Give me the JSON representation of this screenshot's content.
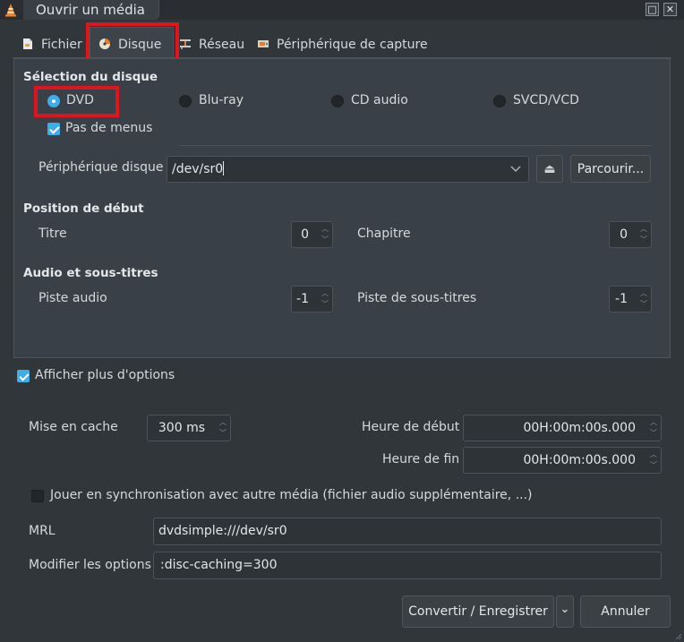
{
  "window": {
    "title": "Ouvrir un média",
    "minimize_glyph": "□",
    "close_glyph": "✕"
  },
  "tabs": [
    {
      "label": "Fichier",
      "mnemonic": "F",
      "icon": "file-icon"
    },
    {
      "label": "Disque",
      "mnemonic": "D",
      "icon": "disc-icon",
      "active": true
    },
    {
      "label": "Réseau",
      "mnemonic": "R",
      "icon": "network-icon"
    },
    {
      "label": "Périphérique de capture",
      "mnemonic": "t",
      "icon": "capture-device-icon"
    }
  ],
  "disc": {
    "selection_heading": "Sélection du disque",
    "types": [
      {
        "label": "DVD",
        "selected": true
      },
      {
        "label": "Blu-ray",
        "selected": false
      },
      {
        "label": "CD audio",
        "selected": false
      },
      {
        "label": "SVCD/VCD",
        "selected": false
      }
    ],
    "no_menus_label": "Pas de menus",
    "no_menus_checked": true,
    "device_label": "Périphérique disque",
    "device_value": "/dev/sr0",
    "eject_glyph": "⏏",
    "browse_label": "Parcourir...",
    "start_heading": "Position de début",
    "title_label": "Titre",
    "title_value": "0",
    "chapter_label": "Chapitre",
    "chapter_value": "0",
    "audio_heading": "Audio et sous-titres",
    "audio_track_label": "Piste audio",
    "audio_track_value": "-1",
    "subtitle_track_label": "Piste de sous-titres",
    "subtitle_track_value": "-1"
  },
  "options": {
    "show_more_label": "Afficher plus d'options",
    "show_more_checked": true,
    "caching_label": "Mise en cache",
    "caching_value": "300 ms",
    "start_time_label": "Heure de début",
    "start_time_value": "00H:00m:00s.000",
    "end_time_label": "Heure de fin",
    "end_time_value": "00H:00m:00s.000",
    "sync_label": "Jouer en synchronisation avec autre média (fichier audio supplémentaire, ...)",
    "sync_checked": false,
    "mrl_label": "MRL",
    "mrl_value": "dvdsimple:///dev/sr0",
    "edit_options_label": "Modifier les options",
    "edit_options_value": ":disc-caching=300"
  },
  "footer": {
    "convert_label": "Convertir / Enregistrer",
    "cancel_label": "Annuler",
    "dropdown_glyph": "⌄"
  },
  "colors": {
    "accent": "#3daee9",
    "highlight_box": "#e1141c",
    "background": "#31363b",
    "panel": "#3a4047"
  }
}
